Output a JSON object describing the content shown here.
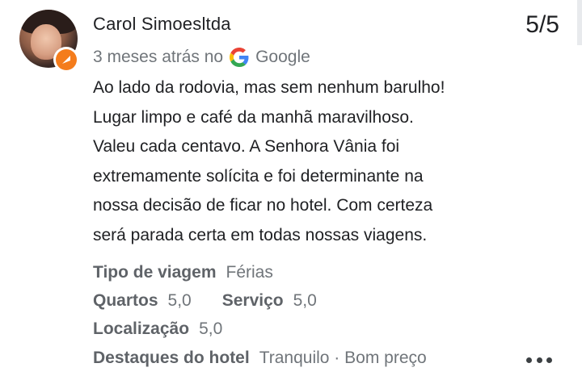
{
  "reviewer": {
    "name": "Carol Simoesltda"
  },
  "rating": "5/5",
  "meta": {
    "time_ago": "3 meses atrás no",
    "source": "Google"
  },
  "review_lines": [
    "Ao lado da rodovia, mas sem nenhum barulho!",
    "Lugar limpo e café da manhã maravilhoso.",
    "Valeu cada centavo. A Senhora Vânia foi",
    "extremamente solícita e foi determinante na",
    "nossa decisão de ficar no hotel. Com certeza",
    "será parada certa em todas nossas viagens."
  ],
  "attributes": {
    "trip_type": {
      "label": "Tipo de viagem",
      "value": "Férias"
    },
    "rooms": {
      "label": "Quartos",
      "value": "5,0"
    },
    "service": {
      "label": "Serviço",
      "value": "5,0"
    },
    "location": {
      "label": "Localização",
      "value": "5,0"
    },
    "highlights": {
      "label": "Destaques do hotel",
      "value": "Tranquilo · Bom preço"
    }
  },
  "icons": {
    "badge": "local-guide-badge-icon",
    "source": "google-g-icon",
    "more": "more-options-icon"
  },
  "colors": {
    "badge_orange": "#f47c1c",
    "text_primary": "#202124",
    "text_secondary": "#70757a"
  }
}
